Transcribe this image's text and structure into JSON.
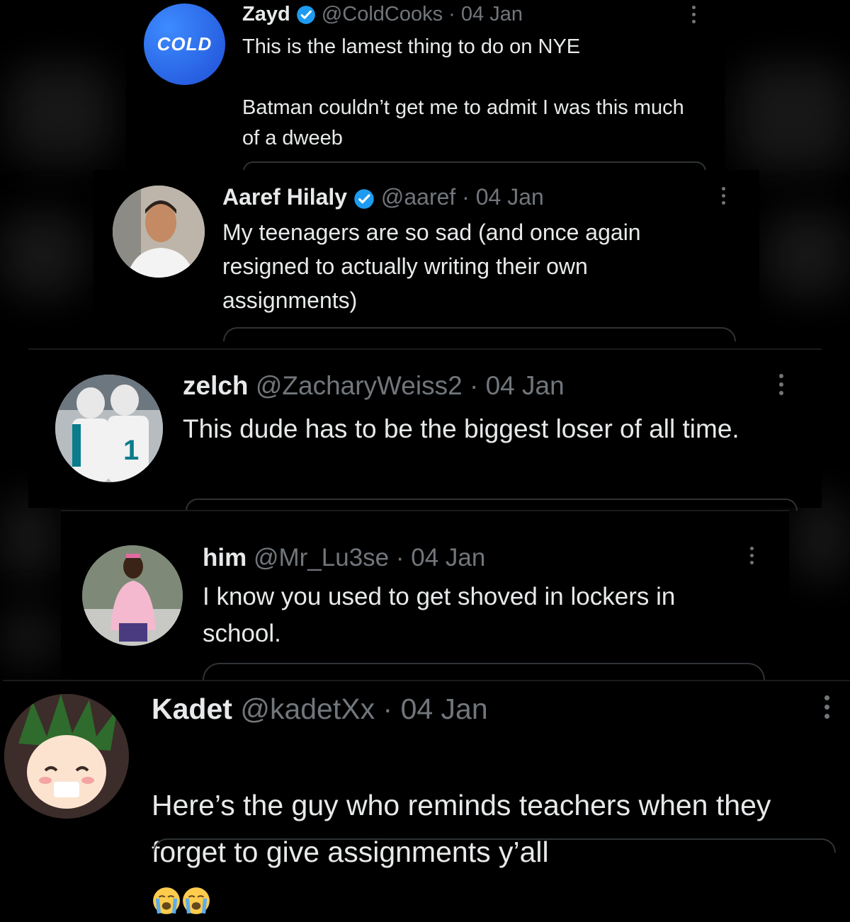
{
  "tweets": [
    {
      "name": "Zayd",
      "handle": "@ColdCooks",
      "sep": "·",
      "date": "04 Jan",
      "text": "This is the lamest thing to do on NYE\n\nBatman couldn’t get me to admit I was this much of a dweeb",
      "avatar_text": "COLD",
      "verified": true
    },
    {
      "name": "Aaref Hilaly",
      "handle": "@aaref",
      "sep": "·",
      "date": "04 Jan",
      "text": "My teenagers are so sad (and once again resigned to actually writing their own assignments)",
      "verified": true
    },
    {
      "name": "zelch",
      "handle": "@ZacharyWeiss2",
      "sep": "·",
      "date": "04 Jan",
      "text": "This dude has to be the biggest loser of all time.",
      "verified": false
    },
    {
      "name": "him",
      "handle": "@Mr_Lu3se",
      "sep": "·",
      "date": "04 Jan",
      "text": "I know you used to get shoved in lockers in school.",
      "verified": false
    },
    {
      "name": "Kadet",
      "handle": "@kadetXx",
      "sep": "·",
      "date": "04 Jan",
      "text": "Here’s the guy who reminds teachers when they forget to give assignments y’all",
      "verified": false,
      "emojis": [
        "loudly-crying-face",
        "loudly-crying-face"
      ]
    }
  ],
  "colors": {
    "accent": "#1d9bf0",
    "muted": "#71767b",
    "text": "#e7e9ea",
    "bg": "#000000"
  }
}
